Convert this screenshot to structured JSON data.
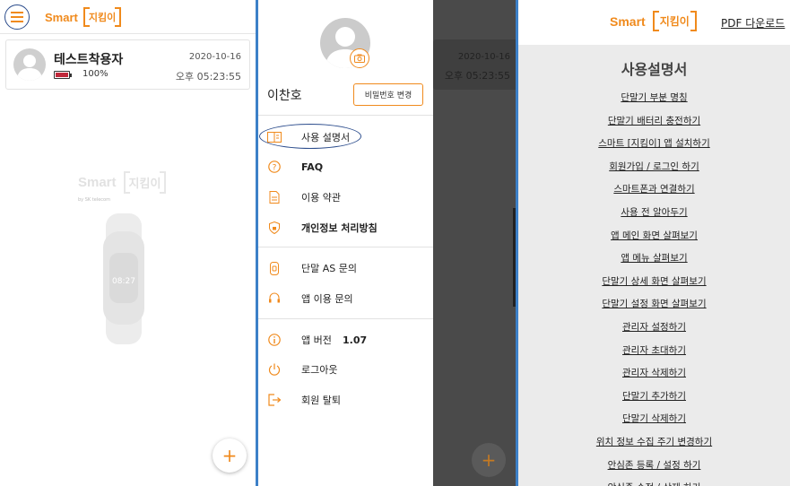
{
  "brand": {
    "smart": "Smart",
    "name": "지킴이",
    "by": "by SK telecom"
  },
  "home": {
    "device": {
      "name": "테스트착용자",
      "battery_pct": "100%",
      "battery_level": 1.0,
      "date": "2020-10-16",
      "time": "오후 05:23:55"
    },
    "watch_time": "08:27",
    "add_label": "+"
  },
  "drawer": {
    "user_name": "이찬호",
    "change_password_label": "비밀번호 변경",
    "items": [
      {
        "label": "사용 설명서",
        "icon": "book-icon"
      },
      {
        "label": "FAQ",
        "icon": "question-icon"
      },
      {
        "label": "이용 약관",
        "icon": "document-icon"
      },
      {
        "label": "개인정보 처리방침",
        "icon": "lock-icon"
      },
      {
        "label": "단말 AS 문의",
        "icon": "device-icon"
      },
      {
        "label": "앱 이용 문의",
        "icon": "headset-icon"
      },
      {
        "label": "앱 버전",
        "icon": "info-icon"
      },
      {
        "label": "로그아웃",
        "icon": "power-icon"
      },
      {
        "label": "회원 탈퇴",
        "icon": "exit-icon"
      }
    ],
    "version": "1.07",
    "background": {
      "date": "2020-10-16",
      "time": "오후 05:23:55",
      "add_label": "+"
    }
  },
  "manual": {
    "pdf_download": "PDF 다운로드",
    "title": "사용설명서",
    "toc": [
      "단말기 부분 명칭",
      "단말기 배터리 충전하기",
      "스마트 [지킴이] 앱 설치하기",
      "회원가입 / 로그인 하기",
      "스마트폰과 연결하기",
      "사용 전 알아두기",
      "앱 메인 화면 살펴보기",
      "앱 메뉴 살펴보기",
      "단말기 상세 화면 살펴보기",
      "단말기 설정 화면 살펴보기",
      "관리자 설정하기",
      "관리자 초대하기",
      "관리자 삭제하기",
      "단말기 추가하기",
      "단말기 삭제하기",
      "위치 정보 수집 주기 변경하기",
      "안심존 등록 / 설정 하기",
      "안심존 수정 / 삭제 하기"
    ]
  },
  "colors": {
    "accent": "#f08a1c",
    "separator": "#3c80c8",
    "highlight": "#2b4c8c",
    "battery": "#c0283b"
  }
}
